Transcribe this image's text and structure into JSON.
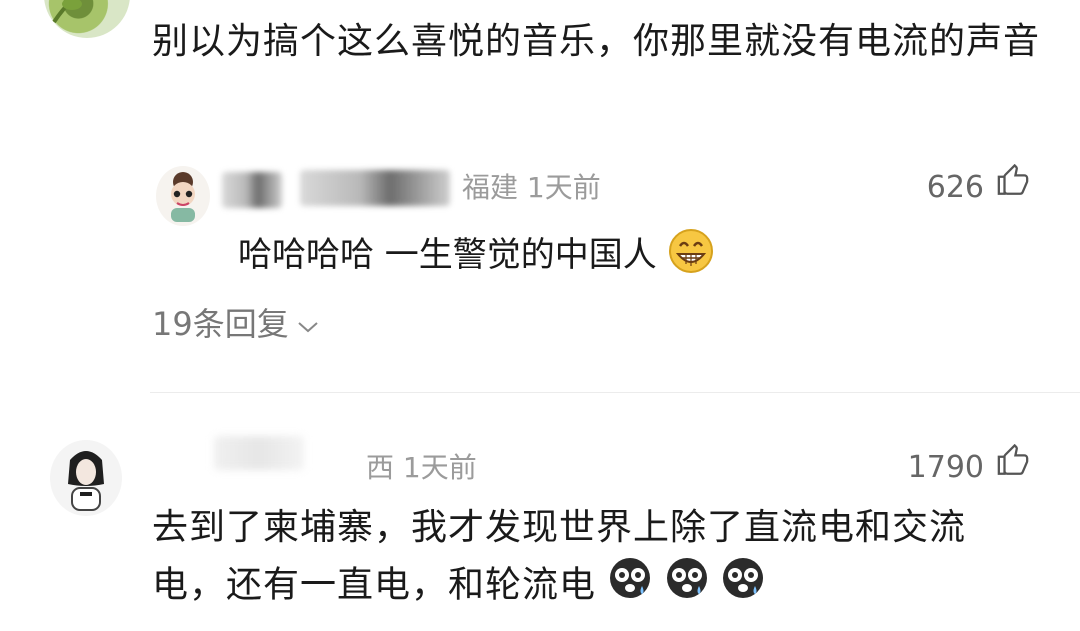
{
  "top_comment": {
    "text": "别以为搞个这么喜悦的音乐，你那里就没有电流的声音"
  },
  "reply_1": {
    "meta": "福建 1天前",
    "likes": "626",
    "text": "哈哈哈哈 一生警觉的中国人",
    "emoji": "grinning-face-icon"
  },
  "replies_link": {
    "label": "19条回复"
  },
  "comment_2": {
    "meta": "西 1天前",
    "likes": "1790",
    "text_line1": "去到了柬埔寨，我才发现世界上除了直流电和交流",
    "text_line2": "电，还有一直电，和轮流电",
    "emoji": "dizzy-crying-face-icon"
  },
  "colors": {
    "meta": "#9b9b9b",
    "text": "#1a1a1a",
    "divider": "#ececec"
  }
}
